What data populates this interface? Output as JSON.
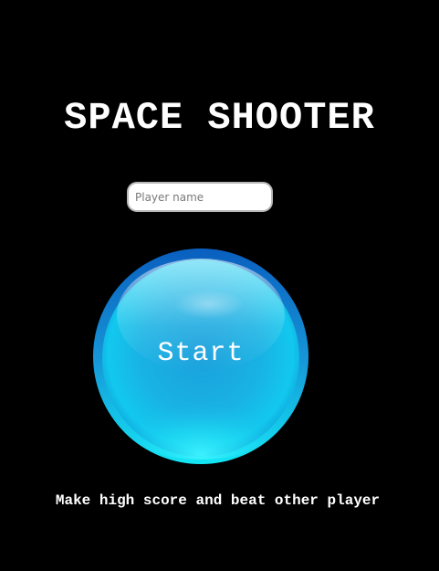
{
  "game": {
    "title": "SPACE SHOOTER",
    "tagline": "Make high score and beat other player"
  },
  "player": {
    "name_value": "",
    "name_placeholder": "Player name"
  },
  "start_button": {
    "label": "Start",
    "icon": "glossy-blue-orb-icon"
  },
  "colors": {
    "background": "#000000",
    "text": "#ffffff",
    "orb_top": "#0a64c4",
    "orb_mid": "#1aa8e0",
    "orb_bottom": "#18e8f6"
  }
}
